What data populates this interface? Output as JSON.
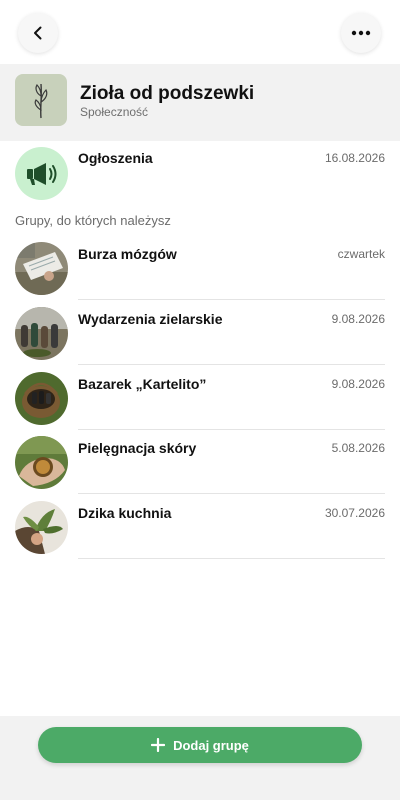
{
  "topbar": {
    "back_icon": "chevron-left-icon",
    "more_icon": "ellipsis-icon"
  },
  "community": {
    "title": "Zioła od podszewki",
    "subtitle": "Społeczność"
  },
  "announcements": {
    "label": "Ogłoszenia",
    "date": "16.08.2026",
    "icon": "megaphone-icon",
    "icon_bg": "#c9f0cf",
    "icon_color": "#1f4e2a"
  },
  "section_label": "Grupy, do których należysz",
  "groups": [
    {
      "name": "Burza mózgów",
      "date": "czwartek"
    },
    {
      "name": "Wydarzenia zielarskie",
      "date": "9.08.2026"
    },
    {
      "name": "Bazarek „Kartelito”",
      "date": "9.08.2026"
    },
    {
      "name": "Pielęgnacja skóry",
      "date": "5.08.2026"
    },
    {
      "name": "Dzika kuchnia",
      "date": "30.07.2026"
    }
  ],
  "add_button": {
    "label": "Dodaj grupę",
    "color": "#4caa67",
    "icon": "plus-icon"
  }
}
